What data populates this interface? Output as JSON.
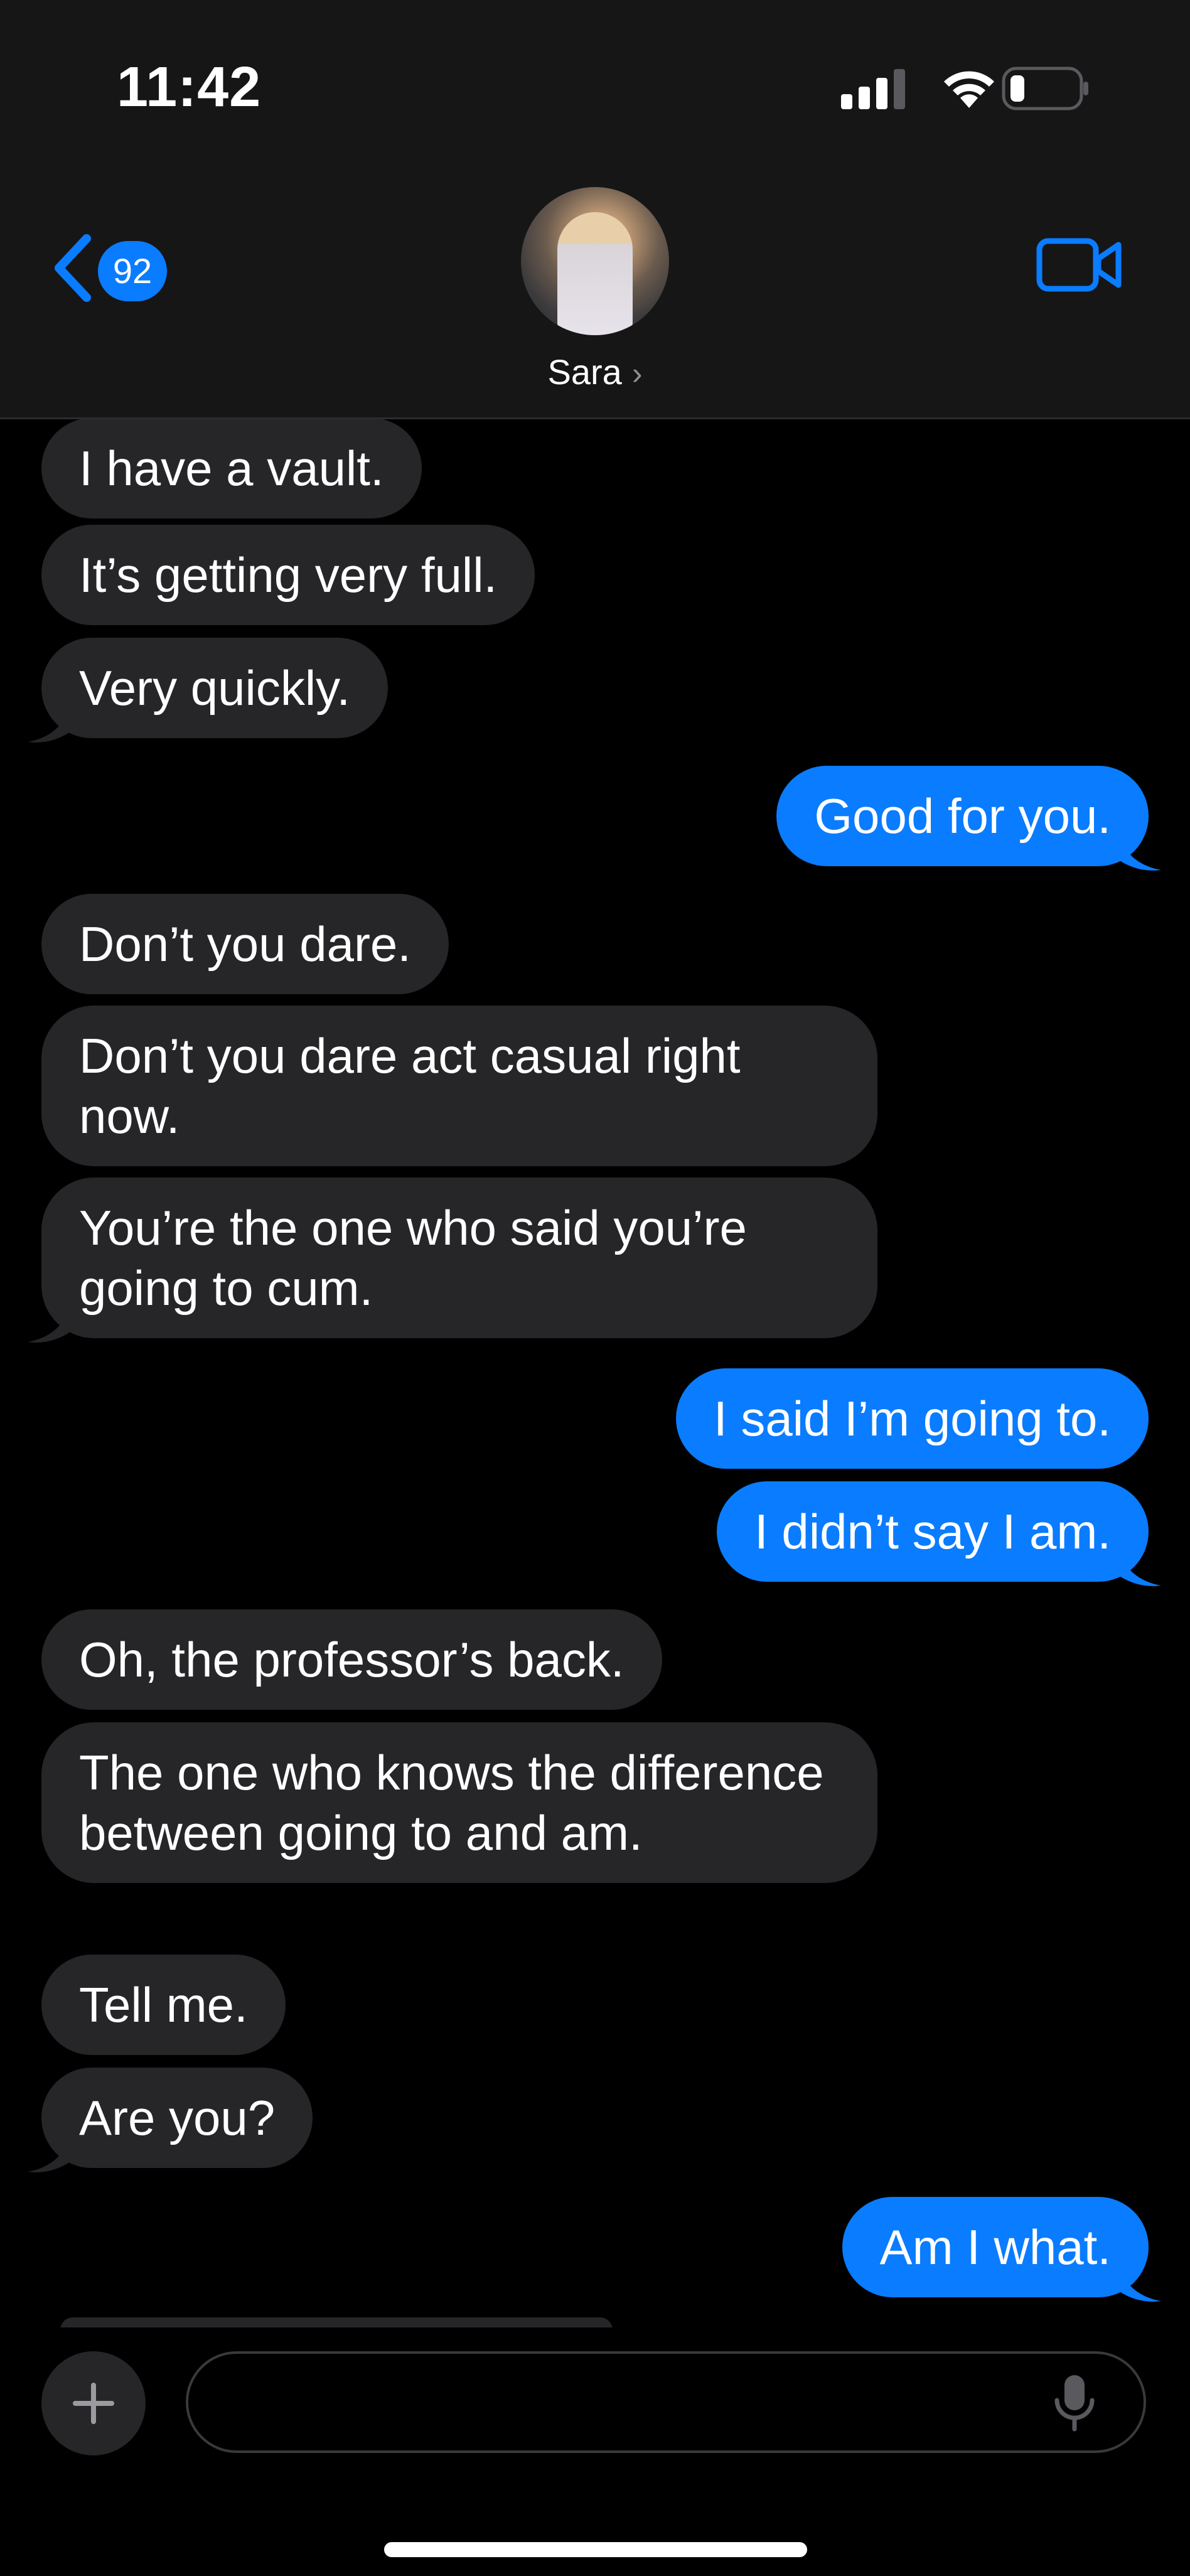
{
  "status_bar": {
    "time": "11:42",
    "icons": [
      "signal-icon",
      "wifi-icon",
      "battery-icon"
    ]
  },
  "nav": {
    "back_badge": "92",
    "contact_name": "Sara",
    "contact_chevron": "›",
    "icons": [
      "back-chevron-icon",
      "video-call-icon",
      "contact-avatar"
    ]
  },
  "messages": [
    {
      "side": "in",
      "text": "I have a vault."
    },
    {
      "side": "in",
      "text": "It’s getting very full."
    },
    {
      "side": "in",
      "text": "Very quickly."
    },
    {
      "side": "out",
      "text": "Good for you."
    },
    {
      "side": "in",
      "text": "Don’t you dare."
    },
    {
      "side": "in",
      "text": "Don’t you dare act casual right now."
    },
    {
      "side": "in",
      "text": "You’re the one who said you’re going to cum."
    },
    {
      "side": "out",
      "text": "I said I’m going to."
    },
    {
      "side": "out",
      "text": "I didn’t say I am."
    },
    {
      "side": "in",
      "text": "Oh, the professor’s back."
    },
    {
      "side": "in",
      "text": "The one who knows the difference between going to and am."
    },
    {
      "side": "in",
      "text": "Tell me."
    },
    {
      "side": "in",
      "text": "Are you?"
    },
    {
      "side": "out",
      "text": "Am I what."
    }
  ],
  "composer": {
    "placeholder": "",
    "value": "",
    "icons": [
      "plus-icon",
      "microphone-icon"
    ]
  },
  "colors": {
    "background": "#000000",
    "header": "#161617",
    "incoming_bubble": "#262628",
    "outgoing_bubble": "#0a7cff",
    "accent": "#0a7cff"
  }
}
